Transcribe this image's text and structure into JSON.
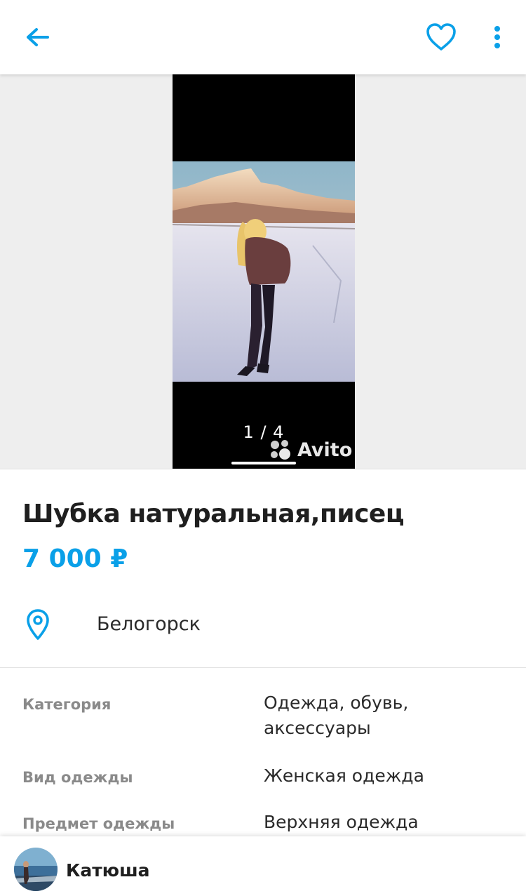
{
  "header": {
    "back_icon": "arrow-left-icon",
    "favorite_icon": "heart-icon",
    "more_icon": "more-vertical-icon",
    "accent_color": "#0aa0e8"
  },
  "gallery": {
    "counter": "1 / 4",
    "watermark": "Avito",
    "current_index": 1,
    "total": 4
  },
  "listing": {
    "title": "Шубка натуральная,писец",
    "price": "7 000 ₽",
    "location": "Белогорск",
    "location_icon": "map-pin-icon"
  },
  "params": [
    {
      "label": "Категория",
      "value": "Одежда, обувь, аксессуары"
    },
    {
      "label": "Вид одежды",
      "value": "Женская одежда"
    },
    {
      "label": "Предмет одежды",
      "value": "Верхняя одежда"
    }
  ],
  "seller": {
    "name": "Катюша"
  }
}
